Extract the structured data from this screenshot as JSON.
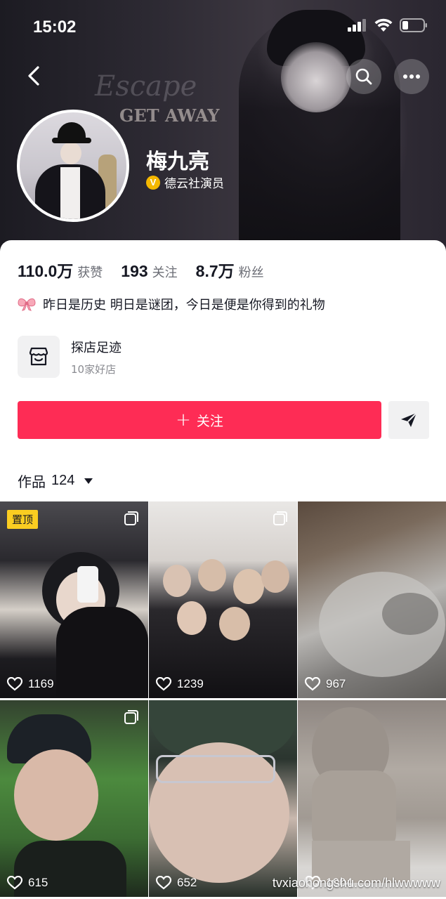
{
  "status_bar": {
    "time": "15:02"
  },
  "cover": {
    "text_line_1": "Escape",
    "text_line_2": "GET AWAY"
  },
  "profile": {
    "name": "梅九亮",
    "verified_badge": "V",
    "verified_title": "德云社演员"
  },
  "stats": [
    {
      "value": "110.0万",
      "label": "获赞"
    },
    {
      "value": "193",
      "label": "关注"
    },
    {
      "value": "8.7万",
      "label": "粉丝"
    }
  ],
  "bio": {
    "text": "昨日是历史 明日是谜团，今日是便是你得到的礼物",
    "icon": "bow-icon"
  },
  "shop": {
    "title": "探店足迹",
    "subtitle": "10家好店"
  },
  "actions": {
    "follow_label": "关注",
    "follow_icon": "plus-icon",
    "share_icon": "send-icon"
  },
  "works": {
    "label": "作品",
    "count": "124"
  },
  "videos": [
    {
      "likes": "1169",
      "pinned": "置顶"
    },
    {
      "likes": "1239"
    },
    {
      "likes": "967"
    },
    {
      "likes": "615"
    },
    {
      "likes": "652"
    },
    {
      "likes": "1004"
    }
  ],
  "watermark": "tvxiaohongshu.com/hlwwwww",
  "colors": {
    "accent": "#fe2c55",
    "pinned_tag": "#facd21",
    "verified": "#f5b800"
  }
}
